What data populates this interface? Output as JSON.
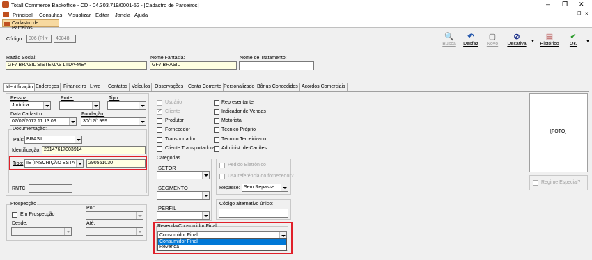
{
  "window": {
    "title": "Totall Commerce Backoffice - CD - 04.303.719/0001-52 - [Cadastro de Parceiros]",
    "min": "–",
    "max": "❐",
    "close": "✕",
    "sub_min": "_",
    "sub_max": "❐",
    "sub_close": "×"
  },
  "menu": [
    "Principal",
    "Consultas",
    "Visualizar",
    "Editar",
    "Janela",
    "Ajuda"
  ],
  "doc_tab": "Cadastro de Parceiros",
  "codigo": {
    "label": "Código:",
    "combo": "006 (Pl ▾",
    "value": "40848"
  },
  "toolbar": [
    {
      "label": "Busca",
      "icon": "🔍",
      "enabled": false
    },
    {
      "label": "Desfaz",
      "icon": "↶",
      "enabled": true
    },
    {
      "label": "Novo",
      "icon": "▢",
      "enabled": false
    },
    {
      "label": "Desativa",
      "icon": "⊘",
      "enabled": true
    },
    {
      "label": "Histórico",
      "icon": "▤",
      "enabled": true
    },
    {
      "label": "OK",
      "icon": "✔",
      "enabled": true
    }
  ],
  "top": {
    "razao_label": "Razão Social:",
    "razao": "GF7 BRASIL SISTEMAS LTDA-ME*",
    "fantasia_label": "Nome Fantasia:",
    "fantasia": "GF7 BRASIL",
    "tratamento_label": "Nome de Tratamento:",
    "tratamento": ""
  },
  "tabs": [
    "Identificação",
    "Endereços",
    "Financeiro",
    "Livre",
    "Contatos",
    "Veículos",
    "Observações",
    "Conta Corrente",
    "Personalizado",
    "Bônus Concedidos",
    "Acordos Comerciais"
  ],
  "ident": {
    "pessoa_label": "Pessoa:",
    "pessoa": "Jurídica",
    "porte_label": "Porte:",
    "porte": "",
    "tipo_label": "Tipo:",
    "tipo": "",
    "datacad_label": "Data Cadastro:",
    "datacad": "07/02/2017 11:13:09",
    "fundacao_label": "Fundação:",
    "fundacao": "30/12/1999"
  },
  "doc": {
    "title": "Documentação:",
    "pais_label": "País:",
    "pais": "BRASIL",
    "ident_label": "Identificação:",
    "ident": "20147617003914",
    "tipo_label": "Tipo:",
    "tipo": "IE (INSCRIÇÃO ESTA",
    "tipo_value": "290551030",
    "rntc_label": "RNTC:",
    "rntc": ""
  },
  "prospec": {
    "title": "Prospecção",
    "chk": "Em Prospecção",
    "por": "Por:",
    "desde": "Desde:",
    "ate": "Até:"
  },
  "roles_left": [
    {
      "label": "Usuário",
      "disabled": true,
      "checked": false
    },
    {
      "label": "Cliente",
      "disabled": true,
      "checked": true
    },
    {
      "label": "Produtor",
      "disabled": false,
      "checked": false
    },
    {
      "label": "Fornecedor",
      "disabled": false,
      "checked": false
    },
    {
      "label": "Transportador",
      "disabled": false,
      "checked": false
    },
    {
      "label": "Cliente Transportadora",
      "disabled": false,
      "checked": false
    }
  ],
  "roles_right": [
    "Representante",
    "Indicador de Vendas",
    "Motorista",
    "Técnico Próprio",
    "Técnico Terceirizado",
    "Administ. de Cartões"
  ],
  "cat": {
    "title": "Categorias",
    "setor": "SETOR",
    "segmento": "SEGMENTO",
    "perfil": "PERFIL"
  },
  "right": {
    "pedido": "Pedido Eletrônico",
    "usa_ref": "Usa referência do fornecedor?",
    "repasse_label": "Repasse:",
    "repasse": "Sem Repasse",
    "cod_alt": "Código alternativo único:"
  },
  "revenda": {
    "title": "Revenda/Consumidor Final",
    "value": "Consumidor Final",
    "options": [
      "Consumidor Final",
      "Revenda"
    ]
  },
  "foto": "[FOTO]",
  "regime": "Regime Especial?"
}
